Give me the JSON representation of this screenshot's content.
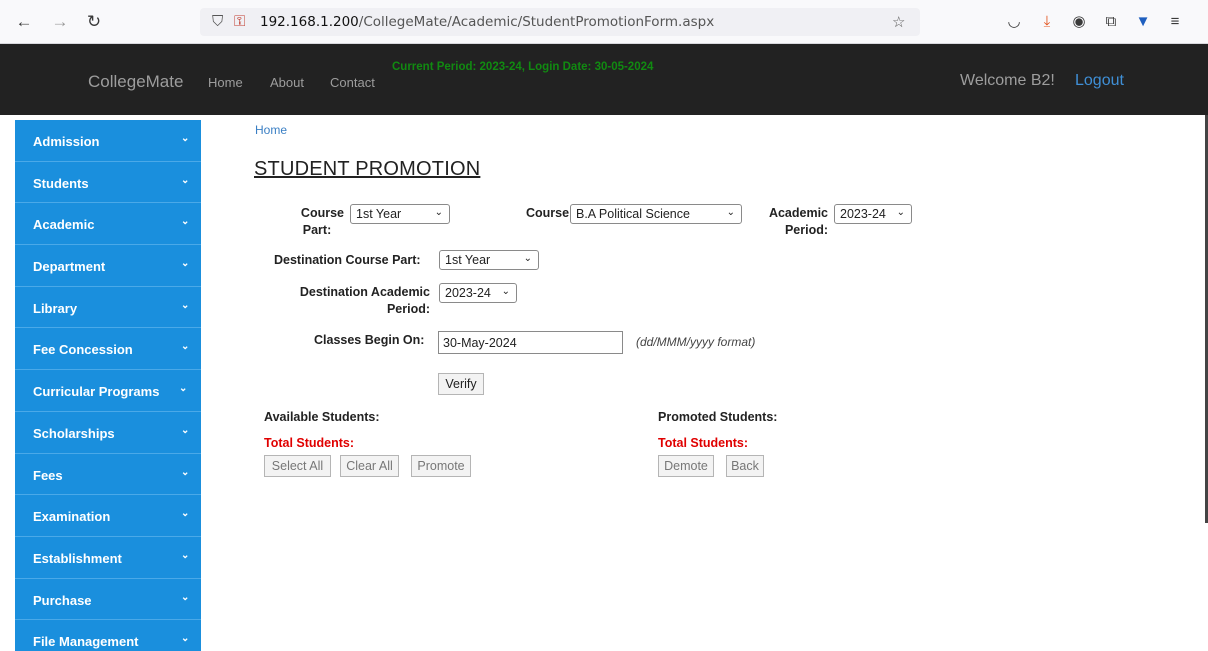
{
  "browser": {
    "url_host": "192.168.1.200",
    "url_path": "/CollegeMate/Academic/StudentPromotionForm.aspx"
  },
  "navbar": {
    "brand": "CollegeMate",
    "links": [
      "Home",
      "About",
      "Contact"
    ],
    "period_text": "Current Period: 2023-24, Login Date: 30-05-2024",
    "welcome": "Welcome B2!",
    "logout": "Logout"
  },
  "sidebar": {
    "items": [
      {
        "label": "Admission"
      },
      {
        "label": "Students"
      },
      {
        "label": "Academic"
      },
      {
        "label": "Department"
      },
      {
        "label": "Library"
      },
      {
        "label": "Fee Concession"
      },
      {
        "label": "Curricular Programs"
      },
      {
        "label": "Scholarships"
      },
      {
        "label": "Fees"
      },
      {
        "label": "Examination"
      },
      {
        "label": "Establishment"
      },
      {
        "label": "Purchase"
      },
      {
        "label": "File Management"
      }
    ],
    "chevron": "⌄"
  },
  "main": {
    "breadcrumb": "Home",
    "title": "STUDENT PROMOTION",
    "course_part_label_1": "Course",
    "course_part_label_2": "Part:",
    "course_part_value": "1st Year",
    "course_label": "Course",
    "course_value": "B.A Political Science",
    "academic_period_label_1": "Academic",
    "academic_period_label_2": "Period:",
    "academic_period_value": "2023-24",
    "dest_course_part_label": "Destination Course Part:",
    "dest_course_part_value": "1st Year",
    "dest_academic_period_label_1": "Destination Academic",
    "dest_academic_period_label_2": "Period:",
    "dest_academic_period_value": "2023-24",
    "classes_begin_label": "Classes Begin On:",
    "classes_begin_value": "30-May-2024",
    "date_format_hint": "(dd/MMM/yyyy format)",
    "verify_button": "Verify",
    "available_label": "Available Students:",
    "available_total_label": "Total Students:",
    "promoted_label": "Promoted Students:",
    "promoted_total_label": "Total Students:",
    "select_all_button": "Select All",
    "clear_all_button": "Clear All",
    "promote_button": "Promote",
    "demote_button": "Demote",
    "back_button": "Back"
  }
}
